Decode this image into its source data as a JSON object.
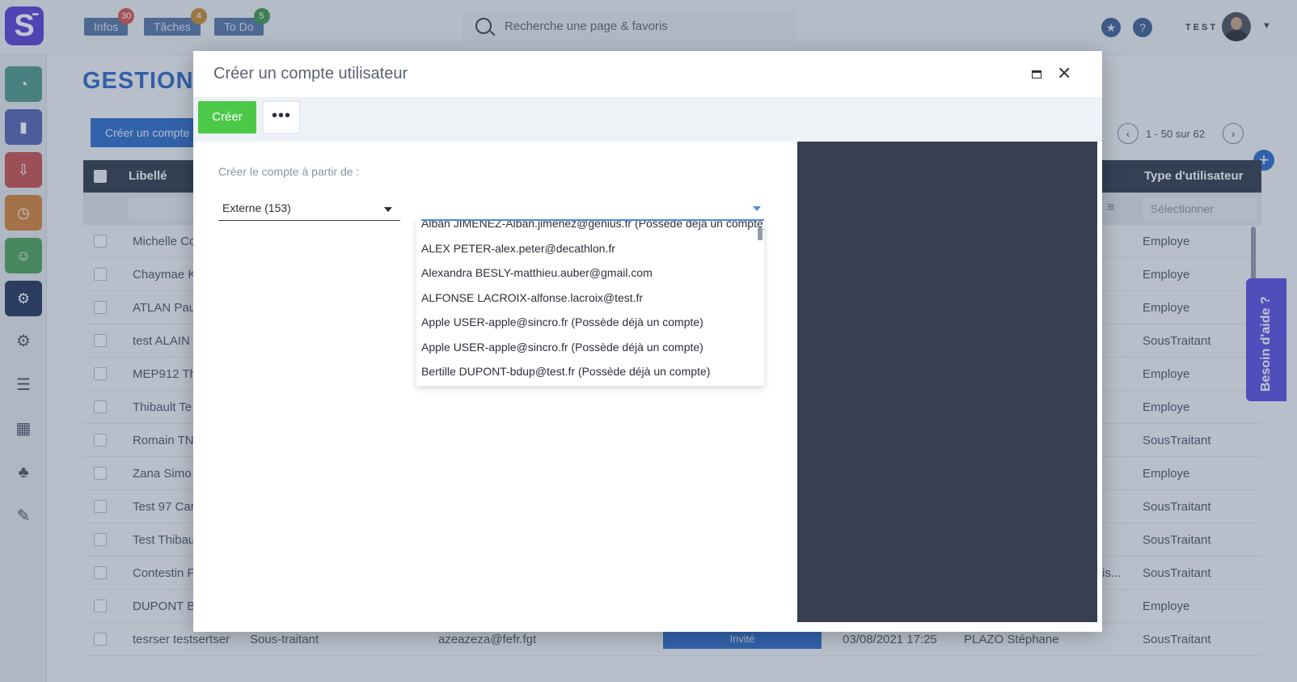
{
  "topbar": {
    "pills": [
      {
        "label": "Infos",
        "badge": "30",
        "badge_color": "#d9534f"
      },
      {
        "label": "Tâches",
        "badge": "4",
        "badge_color": "#c98b2f"
      },
      {
        "label": "To Do",
        "badge": "5",
        "badge_color": "#3f9a4c"
      }
    ],
    "search_placeholder": "Recherche une page & favoris",
    "user_label": "TEST"
  },
  "page": {
    "title": "GESTION",
    "create_button": "Créer un compte",
    "pagination": "1 - 50 sur 62",
    "help_label": "Besoin d'aide ?"
  },
  "table": {
    "headers": {
      "label": "Libellé",
      "user_type": "Type d'utilisateur"
    },
    "filter_select": "Sélectionner",
    "rows": [
      {
        "label": "Michelle Co",
        "type": "Employe"
      },
      {
        "label": "Chaymae K",
        "type": "Employe"
      },
      {
        "label": "ATLAN Pau",
        "type": "Employe"
      },
      {
        "label": "test ALAIN",
        "type": "SousTraitant"
      },
      {
        "label": "MEP912 Th",
        "type": "Employe"
      },
      {
        "label": "Thibault Te",
        "type": "Employe"
      },
      {
        "label": "Romain TN",
        "type": "SousTraitant"
      },
      {
        "label": "Zana Simo",
        "type": "Employe"
      },
      {
        "label": "Test 97 Car",
        "type": "SousTraitant"
      },
      {
        "label": "Test Thibau",
        "type": "SousTraitant"
      },
      {
        "label": "Contestin P",
        "type": "SousTraitant",
        "extra": "is..."
      },
      {
        "label": "DUPONT B",
        "type": "Employe"
      },
      {
        "label": "tesrser testsertser",
        "role": "Sous-traitant",
        "email": "azeazeza@fefr.fgt",
        "status": "Invité",
        "date": "03/08/2021 17:25",
        "creator": "PLAZO Stéphane",
        "type": "SousTraitant"
      }
    ]
  },
  "modal": {
    "title": "Créer un compte utilisateur",
    "create_button": "Créer",
    "more_button": "•••",
    "source_label": "Créer le compte à partir de :",
    "source_value": "Externe (153)",
    "combo_value": "",
    "options": [
      "Alban JIMENEZ-Alban.jimenez@genius.fr (Possède déjà un compte)",
      "ALEX PETER-alex.peter@decathlon.fr",
      "Alexandra BESLY-matthieu.auber@gmail.com",
      "ALFONSE LACROIX-alfonse.lacroix@test.fr",
      "Apple USER-apple@sincro.fr (Possède déjà un compte)",
      "Apple USER-apple@sincro.fr (Possède déjà un compte)",
      "Bertille DUPONT-bdup@test.fr (Possède déjà un compte)"
    ]
  },
  "icons": {
    "maximize": "maximize-icon",
    "close": "close-icon",
    "search": "search-icon",
    "star": "star-icon",
    "help": "question-icon"
  }
}
